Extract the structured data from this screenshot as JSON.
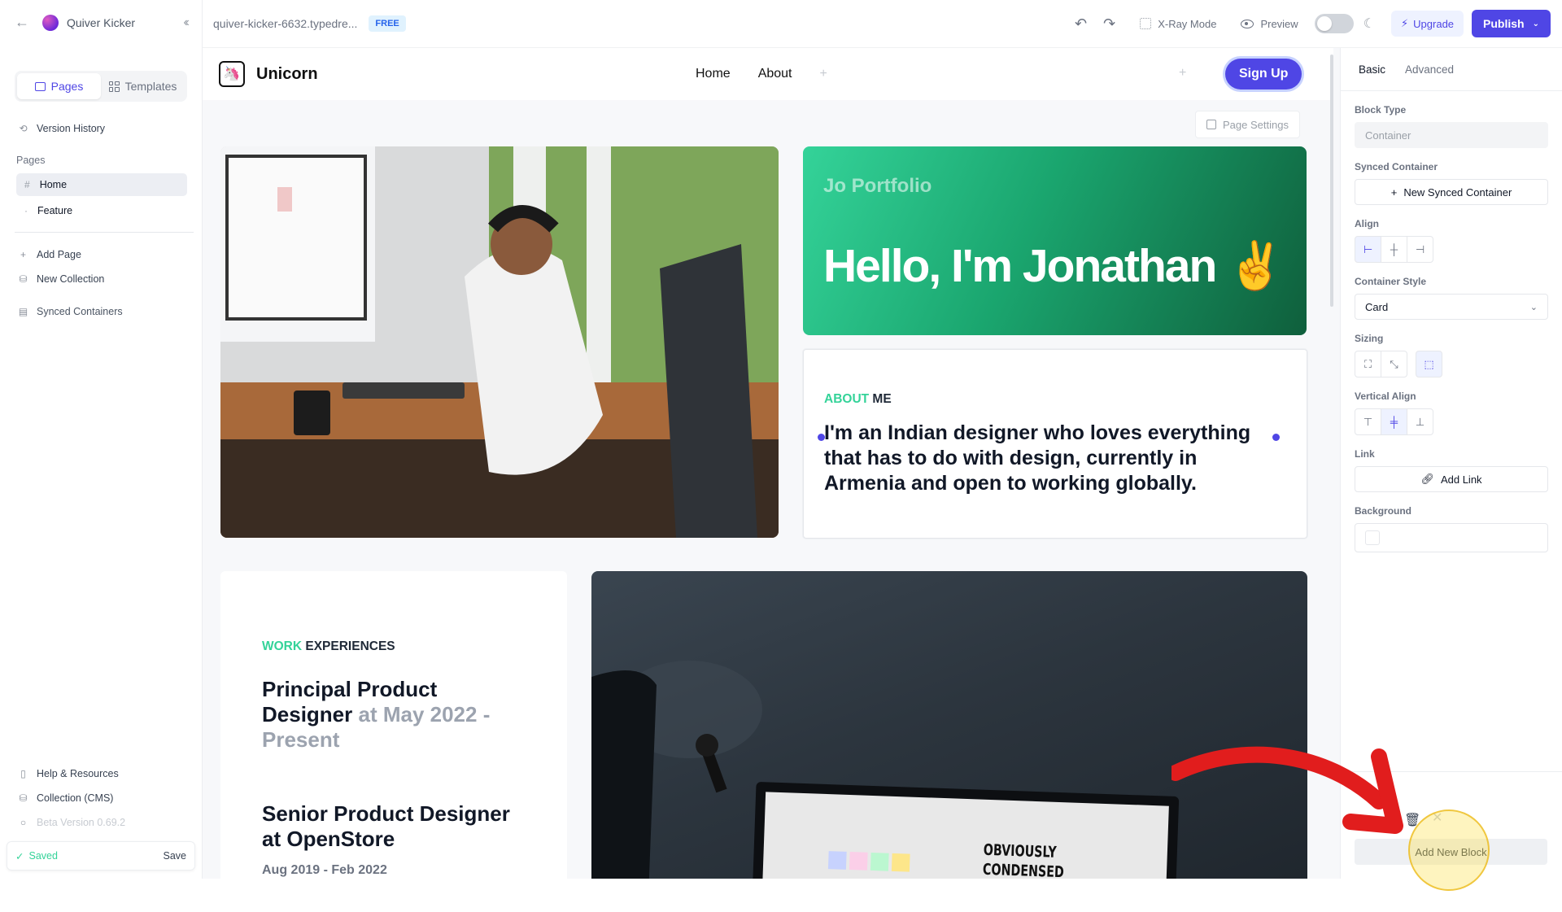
{
  "app": {
    "name": "Quiver Kicker",
    "url": "quiver-kicker-6632.typedre...",
    "plan_badge": "FREE"
  },
  "sidebar": {
    "tabs": [
      {
        "label": "Pages",
        "active": true
      },
      {
        "label": "Templates",
        "active": false
      }
    ],
    "version_history": "Version History",
    "pages_heading": "Pages",
    "pages": [
      {
        "label": "Home",
        "active": true
      },
      {
        "label": "Feature",
        "active": false
      }
    ],
    "add_page": "Add Page",
    "new_collection": "New Collection",
    "synced_containers": "Synced Containers",
    "help": "Help & Resources",
    "collection_cms": "Collection (CMS)",
    "beta_version": "Beta Version 0.69.2",
    "saved_status": "Saved",
    "save_label": "Save"
  },
  "toolbar": {
    "xray_label": "X-Ray Mode",
    "preview_label": "Preview",
    "upgrade_label": "Upgrade",
    "publish_label": "Publish"
  },
  "site": {
    "brand": "Unicorn",
    "nav": [
      "Home",
      "About"
    ],
    "signup": "Sign Up",
    "page_settings": "Page Settings",
    "hero_subtitle": "Jo Portfolio",
    "hero_title": "Hello, I'm Jonathan ✌️",
    "about_label_accent": "ABOUT",
    "about_label_rest": " ME",
    "about_text": "I'm an Indian designer who loves everything that has to do with design, currently in Armenia and open to working globally.",
    "work_label_accent": "WORK",
    "work_label_rest": " EXPERIENCES",
    "jobs": [
      {
        "title": "Principal Product Designer",
        "meta": " at May 2022 - Present"
      },
      {
        "title": "Senior Product Designer at OpenStore",
        "dates": "Aug 2019 - Feb 2022"
      }
    ],
    "monitor_text_1": "OBVIOUSLY",
    "monitor_text_2": "CONDENSED"
  },
  "inspector": {
    "tabs": [
      {
        "label": "Basic",
        "active": true
      },
      {
        "label": "Advanced",
        "active": false
      }
    ],
    "block_type_label": "Block Type",
    "block_type_value": "Container",
    "synced_container_label": "Synced Container",
    "new_synced_container": "New Synced Container",
    "align_label": "Align",
    "container_style_label": "Container Style",
    "container_style_value": "Card",
    "sizing_label": "Sizing",
    "vertical_align_label": "Vertical Align",
    "link_label": "Link",
    "add_link": "Add Link",
    "background_label": "Background",
    "add_new_block": "Add New Block"
  },
  "colors": {
    "accent": "#4f46e5",
    "hero_green": "#34d399",
    "hero_dark": "#0f5f3c",
    "arrow_red": "#e11d1d"
  }
}
